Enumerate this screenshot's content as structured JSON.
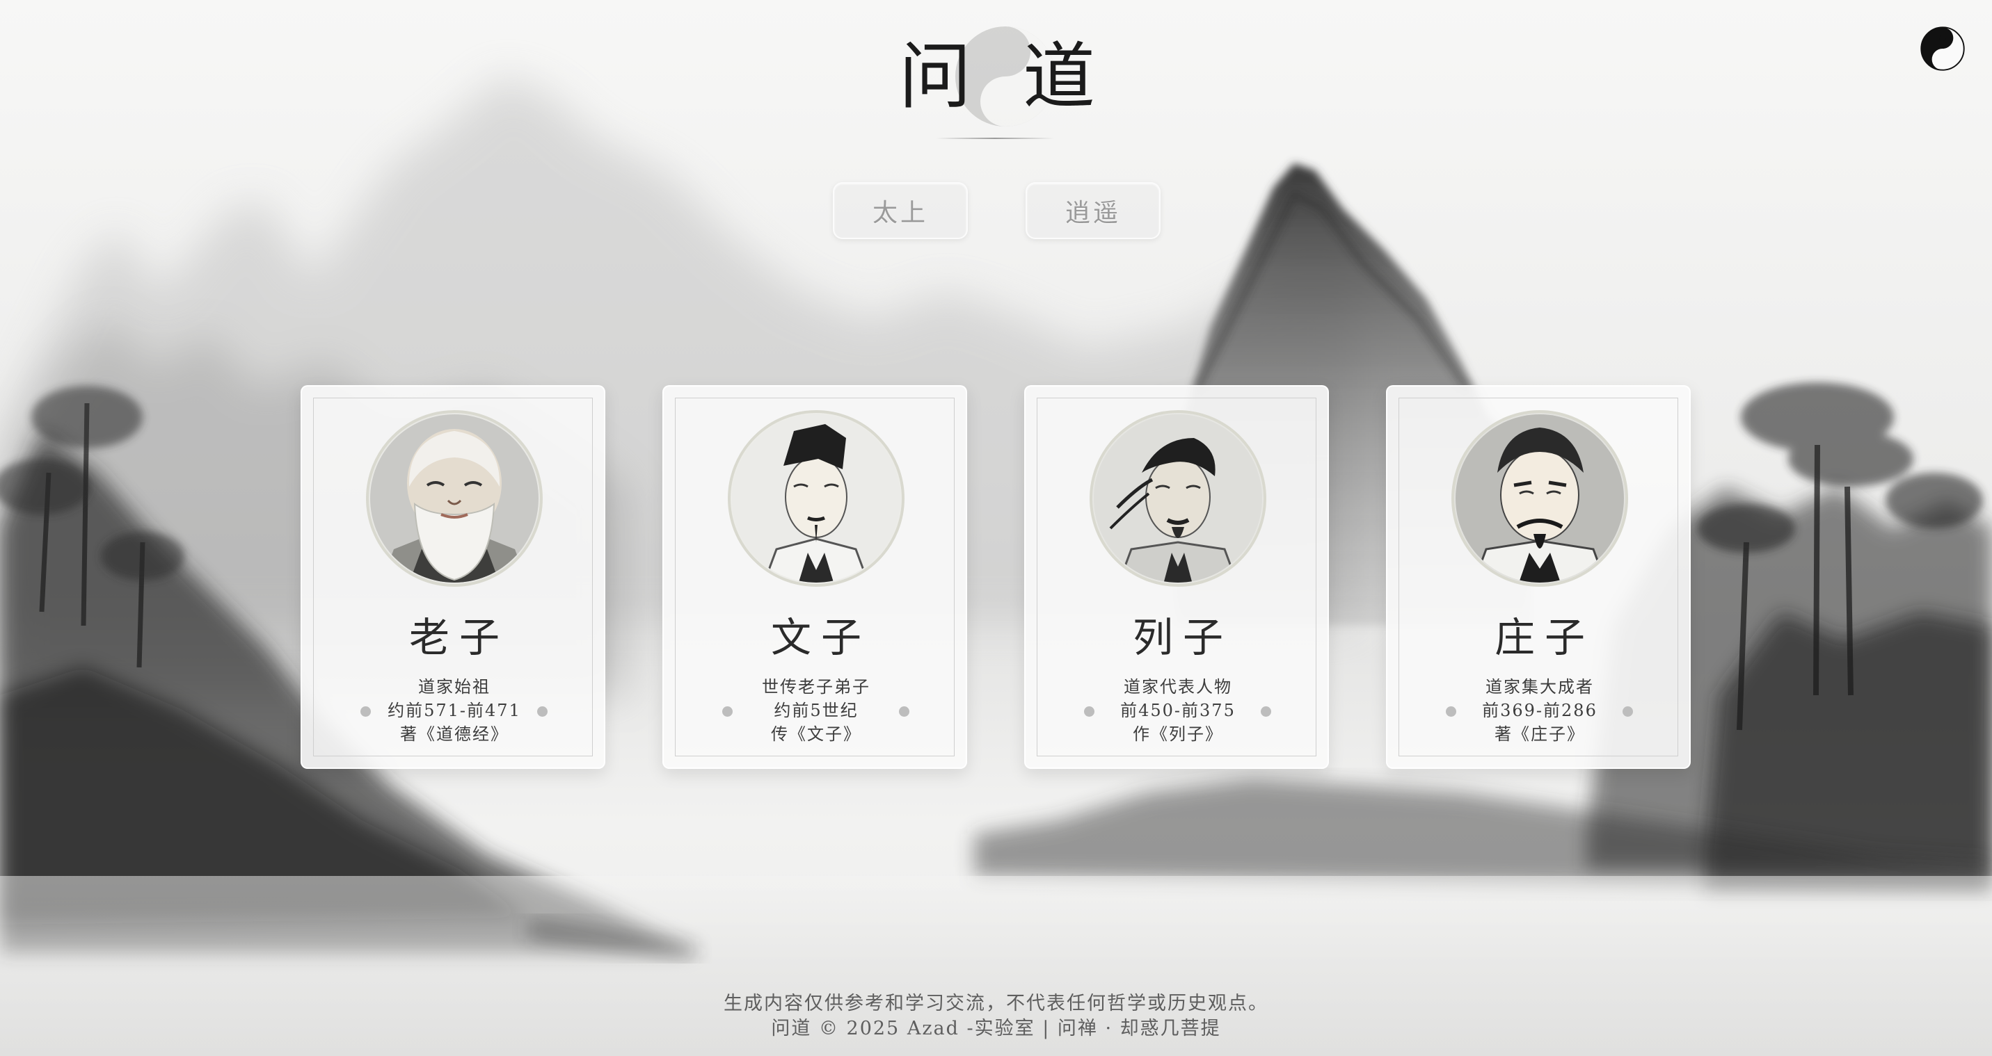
{
  "header": {
    "title_left": "问",
    "title_right": "道"
  },
  "modes": [
    {
      "label": "太上"
    },
    {
      "label": "逍遥"
    }
  ],
  "sages": [
    {
      "name": "老子",
      "desc": [
        "道家始祖",
        "约前571-前471",
        "著《道德经》"
      ],
      "portrait": "laozi-portrait"
    },
    {
      "name": "文子",
      "desc": [
        "世传老子弟子",
        "约前5世纪",
        "传《文子》"
      ],
      "portrait": "wenzi-portrait"
    },
    {
      "name": "列子",
      "desc": [
        "道家代表人物",
        "前450-前375",
        "作《列子》"
      ],
      "portrait": "liezi-portrait"
    },
    {
      "name": "庄子",
      "desc": [
        "道家集大成者",
        "前369-前286",
        "著《庄子》"
      ],
      "portrait": "zhuangzi-portrait"
    }
  ],
  "footer": {
    "disclaimer": "生成内容仅供参考和学习交流，不代表任何哲学或历史观点。",
    "copyright": "问道 © 2025 Azad -实验室 | 问禅 · 却惑几菩提"
  },
  "icons": {
    "theme_toggle": "yin-yang-icon",
    "logo_emblem": "yin-yang-emblem"
  },
  "colors": {
    "ink": "#1b1b1b",
    "mist": "#ededec",
    "card": "#fafafa",
    "button_text": "#9a9a9a"
  }
}
